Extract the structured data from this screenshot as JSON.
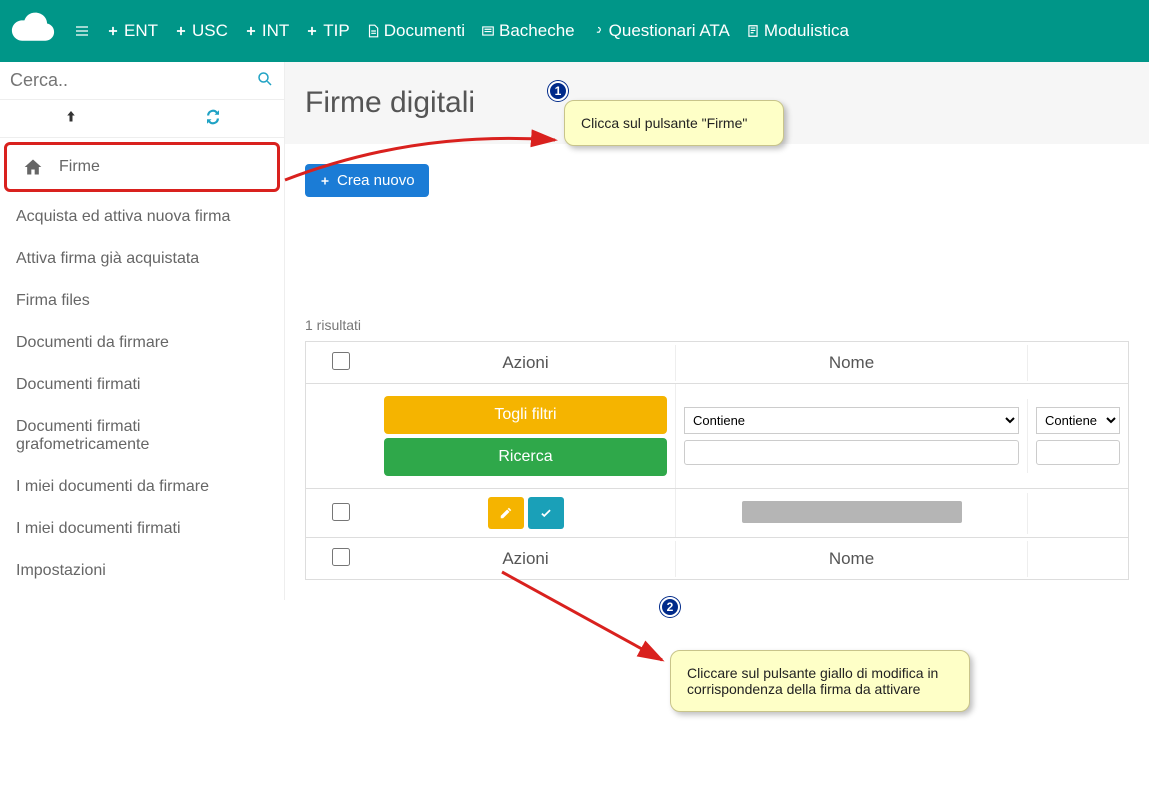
{
  "topbar": {
    "items": [
      {
        "label": "ENT"
      },
      {
        "label": "USC"
      },
      {
        "label": "INT"
      },
      {
        "label": "TIP"
      },
      {
        "label": "Documenti"
      },
      {
        "label": "Bacheche"
      },
      {
        "label": "Questionari ATA"
      },
      {
        "label": "Modulistica"
      }
    ]
  },
  "search": {
    "placeholder": "Cerca.."
  },
  "sidebar": {
    "items": [
      {
        "label": "Firme",
        "active": true
      },
      {
        "label": "Acquista ed attiva nuova firma"
      },
      {
        "label": "Attiva firma già acquistata"
      },
      {
        "label": "Firma files"
      },
      {
        "label": "Documenti da firmare"
      },
      {
        "label": "Documenti firmati"
      },
      {
        "label": "Documenti firmati grafometricamente"
      },
      {
        "label": "I miei documenti da firmare"
      },
      {
        "label": "I miei documenti firmati"
      },
      {
        "label": "Impostazioni"
      }
    ]
  },
  "page": {
    "title": "Firme digitali",
    "create_label": "Crea nuovo",
    "results_label": "1 risultati"
  },
  "table": {
    "col_actions": "Azioni",
    "col_name": "Nome",
    "toggle_filters": "Togli filtri",
    "search_label": "Ricerca",
    "filter_contains": "Contiene"
  },
  "callouts": {
    "step1_num": "1",
    "step1_text": "Clicca sul pulsante \"Firme\"",
    "step2_num": "2",
    "step2_text": "Cliccare sul pulsante giallo di modifica in corrispondenza della firma da attivare"
  }
}
